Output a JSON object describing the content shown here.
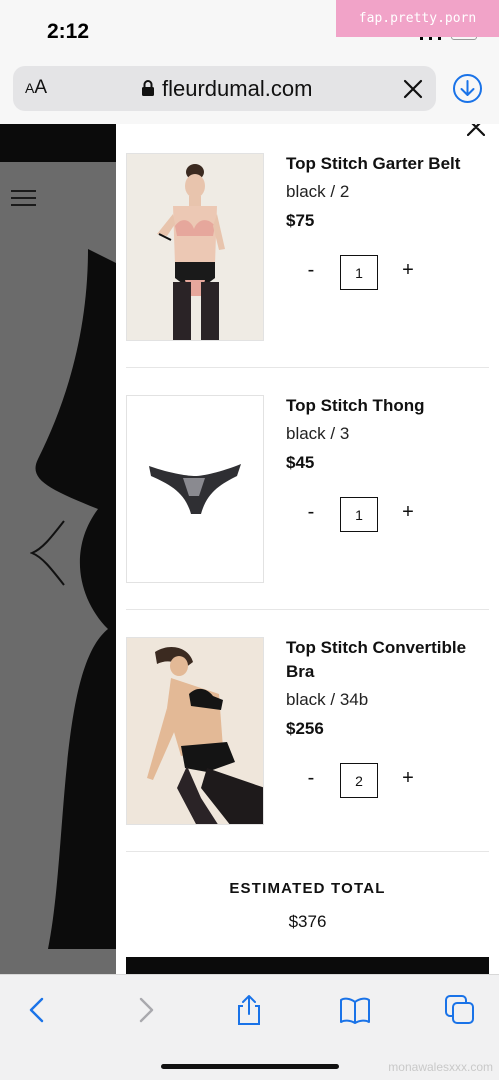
{
  "status_bar": {
    "time": "2:12",
    "watermark_badge": "fap.pretty.porn"
  },
  "address_bar": {
    "text_size_label_small": "A",
    "text_size_label_large": "A",
    "url": "fleurdumal.com"
  },
  "cart": {
    "items": [
      {
        "name": "Top Stitch Garter Belt",
        "variant": "black / 2",
        "price": "$75",
        "qty_minus": "-",
        "quantity": "1",
        "qty_plus": "+"
      },
      {
        "name": "Top Stitch Thong",
        "variant": "black / 3",
        "price": "$45",
        "qty_minus": "-",
        "quantity": "1",
        "qty_plus": "+"
      },
      {
        "name": "Top Stitch Convertible Bra",
        "variant": "black / 34b",
        "price": "$256",
        "qty_minus": "-",
        "quantity": "2",
        "qty_plus": "+"
      }
    ],
    "total_label": "ESTIMATED TOTAL",
    "total_value": "$376"
  },
  "footer": {
    "watermark": "monawalesxxx.com"
  },
  "colors": {
    "badge": "#f1a3c8",
    "accent_blue": "#1a73e8",
    "overlay": "#6b6b6b",
    "drawer": "#ffffff"
  }
}
